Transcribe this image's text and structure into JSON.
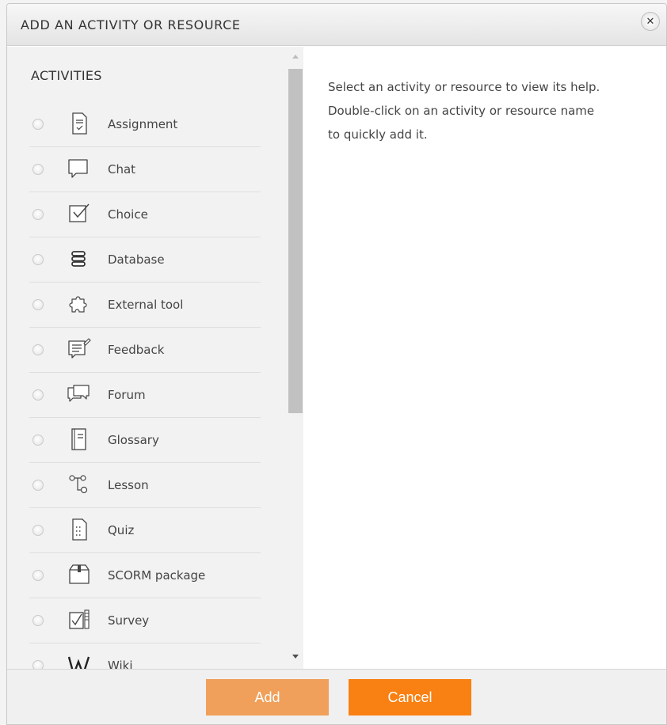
{
  "dialog": {
    "title": "ADD AN ACTIVITY OR RESOURCE",
    "close_icon": "close-icon"
  },
  "activities": {
    "section_title": "ACTIVITIES",
    "items": [
      {
        "label": "Assignment",
        "icon": "assignment-icon"
      },
      {
        "label": "Chat",
        "icon": "chat-icon"
      },
      {
        "label": "Choice",
        "icon": "choice-icon"
      },
      {
        "label": "Database",
        "icon": "database-icon"
      },
      {
        "label": "External tool",
        "icon": "external-tool-icon"
      },
      {
        "label": "Feedback",
        "icon": "feedback-icon"
      },
      {
        "label": "Forum",
        "icon": "forum-icon"
      },
      {
        "label": "Glossary",
        "icon": "glossary-icon"
      },
      {
        "label": "Lesson",
        "icon": "lesson-icon"
      },
      {
        "label": "Quiz",
        "icon": "quiz-icon"
      },
      {
        "label": "SCORM package",
        "icon": "scorm-package-icon"
      },
      {
        "label": "Survey",
        "icon": "survey-icon"
      },
      {
        "label": "Wiki",
        "icon": "wiki-icon"
      }
    ]
  },
  "help": {
    "line1": "Select an activity or resource to view its help.",
    "line2": "Double-click on an activity or resource name",
    "line3": "to quickly add it."
  },
  "footer": {
    "add_label": "Add",
    "cancel_label": "Cancel"
  },
  "colors": {
    "add_button": "#f0a05a",
    "cancel_button": "#f98012",
    "list_background": "#f2f2f2",
    "scroll_thumb": "#c1c1c1"
  }
}
